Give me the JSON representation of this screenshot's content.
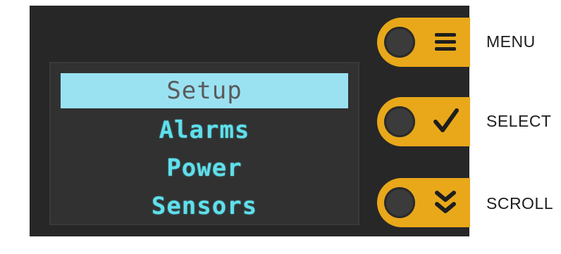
{
  "display": {
    "menu_items": [
      {
        "label": "Setup",
        "selected": true
      },
      {
        "label": "Alarms",
        "selected": false
      },
      {
        "label": "Power",
        "selected": false
      },
      {
        "label": "Sensors",
        "selected": false
      }
    ]
  },
  "buttons": [
    {
      "label": "MENU",
      "icon": "hamburger-icon"
    },
    {
      "label": "SELECT",
      "icon": "checkmark-icon"
    },
    {
      "label": "SCROLL",
      "icon": "double-chevron-down-icon"
    }
  ],
  "colors": {
    "panel": "#272727",
    "screen": "#313131",
    "highlight": "#9ae2f2",
    "menu_text": "#5fe0ec",
    "button": "#e8a81a",
    "knob": "#3b3b3b"
  }
}
